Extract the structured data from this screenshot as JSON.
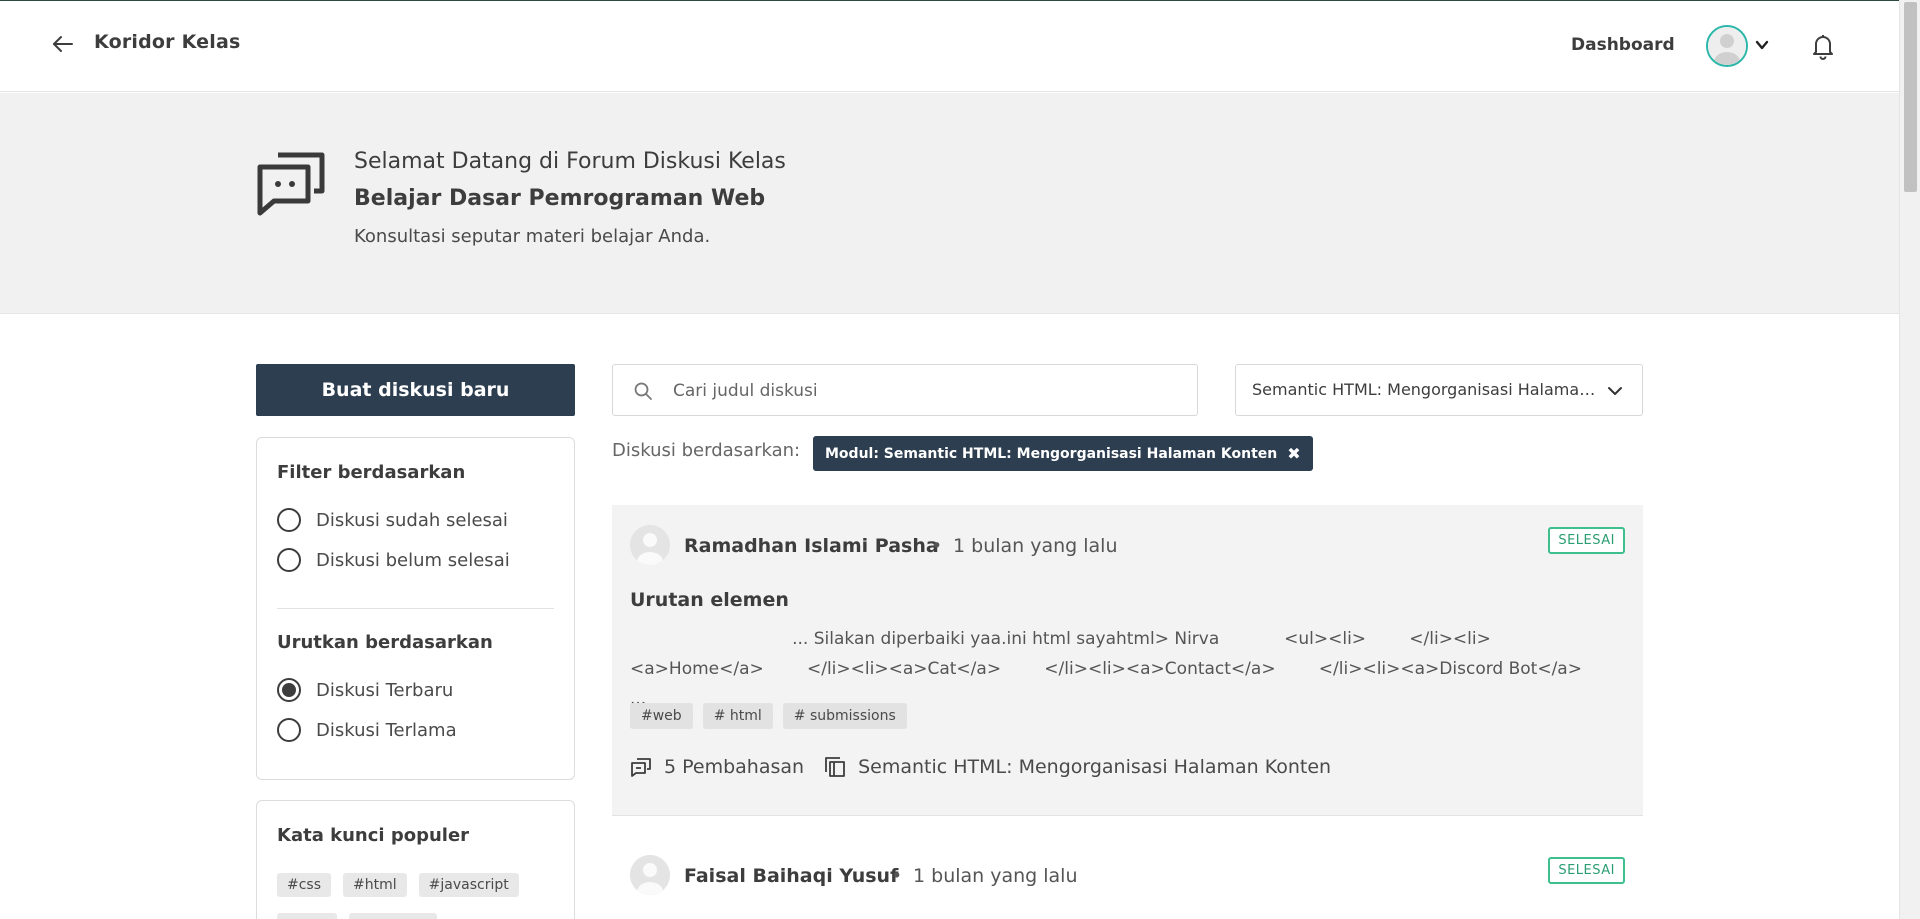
{
  "header": {
    "brand": "Koridor Kelas",
    "dashboard_label": "Dashboard"
  },
  "hero": {
    "welcome": "Selamat Datang di Forum Diskusi Kelas",
    "class_name": "Belajar Dasar Pemrograman Web",
    "subtitle": "Konsultasi seputar materi belajar Anda."
  },
  "sidebar": {
    "new_discussion_label": "Buat diskusi baru",
    "filter_title": "Filter berdasarkan",
    "filter_options": [
      {
        "label": "Diskusi sudah selesai",
        "checked": false
      },
      {
        "label": "Diskusi belum selesai",
        "checked": false
      }
    ],
    "sort_title": "Urutkan berdasarkan",
    "sort_options": [
      {
        "label": "Diskusi Terbaru",
        "checked": true
      },
      {
        "label": "Diskusi Terlama",
        "checked": false
      }
    ],
    "keywords_title": "Kata kunci populer",
    "keywords": [
      "#css",
      "#html",
      "#javascript",
      "",
      ""
    ]
  },
  "search": {
    "placeholder": "Cari judul diskusi",
    "value": ""
  },
  "module_select": {
    "selected": "Semantic HTML: Mengorganisasi Halaman Konten"
  },
  "active_filter": {
    "label": "Diskusi berdasarkan:",
    "chip": "Modul: Semantic HTML: Mengorganisasi Halaman Konten",
    "close": "✖"
  },
  "discussions": [
    {
      "author": "Ramadhan Islami Pasha",
      "separator": "•",
      "time": "1 bulan yang lalu",
      "status": "SELESAI",
      "title": "Urutan elemen",
      "excerpt": "                              ... Silakan diperbaiki yaa.ini html sayahtml> Nirva            <ul><li>        </li><li>\n<a>Home</a>        </li><li><a>Cat</a>        </li><li><a>Contact</a>        </li><li><a>Discord Bot</a>   ...",
      "tags": [
        "#web",
        "# html",
        "# submissions"
      ],
      "replies": "5 Pembahasan",
      "module": "Semantic HTML: Mengorganisasi Halaman Konten"
    },
    {
      "author": "Faisal Baihaqi Yusuf",
      "separator": "•",
      "time": "1 bulan yang lalu",
      "status": "SELESAI"
    }
  ],
  "colors": {
    "primary_dark": "#2d3e50",
    "accent_teal": "#2ab7a9",
    "status_green": "#3dbf8e",
    "hero_bg": "#f1f1f1"
  },
  "icons": {
    "back": "arrow-left-icon",
    "avatar": "user-avatar-icon",
    "chevron": "chevron-down-icon",
    "bell": "bell-icon",
    "hero": "chat-bubbles-icon",
    "search": "search-icon",
    "replies": "comments-icon",
    "module": "module-copy-icon"
  }
}
